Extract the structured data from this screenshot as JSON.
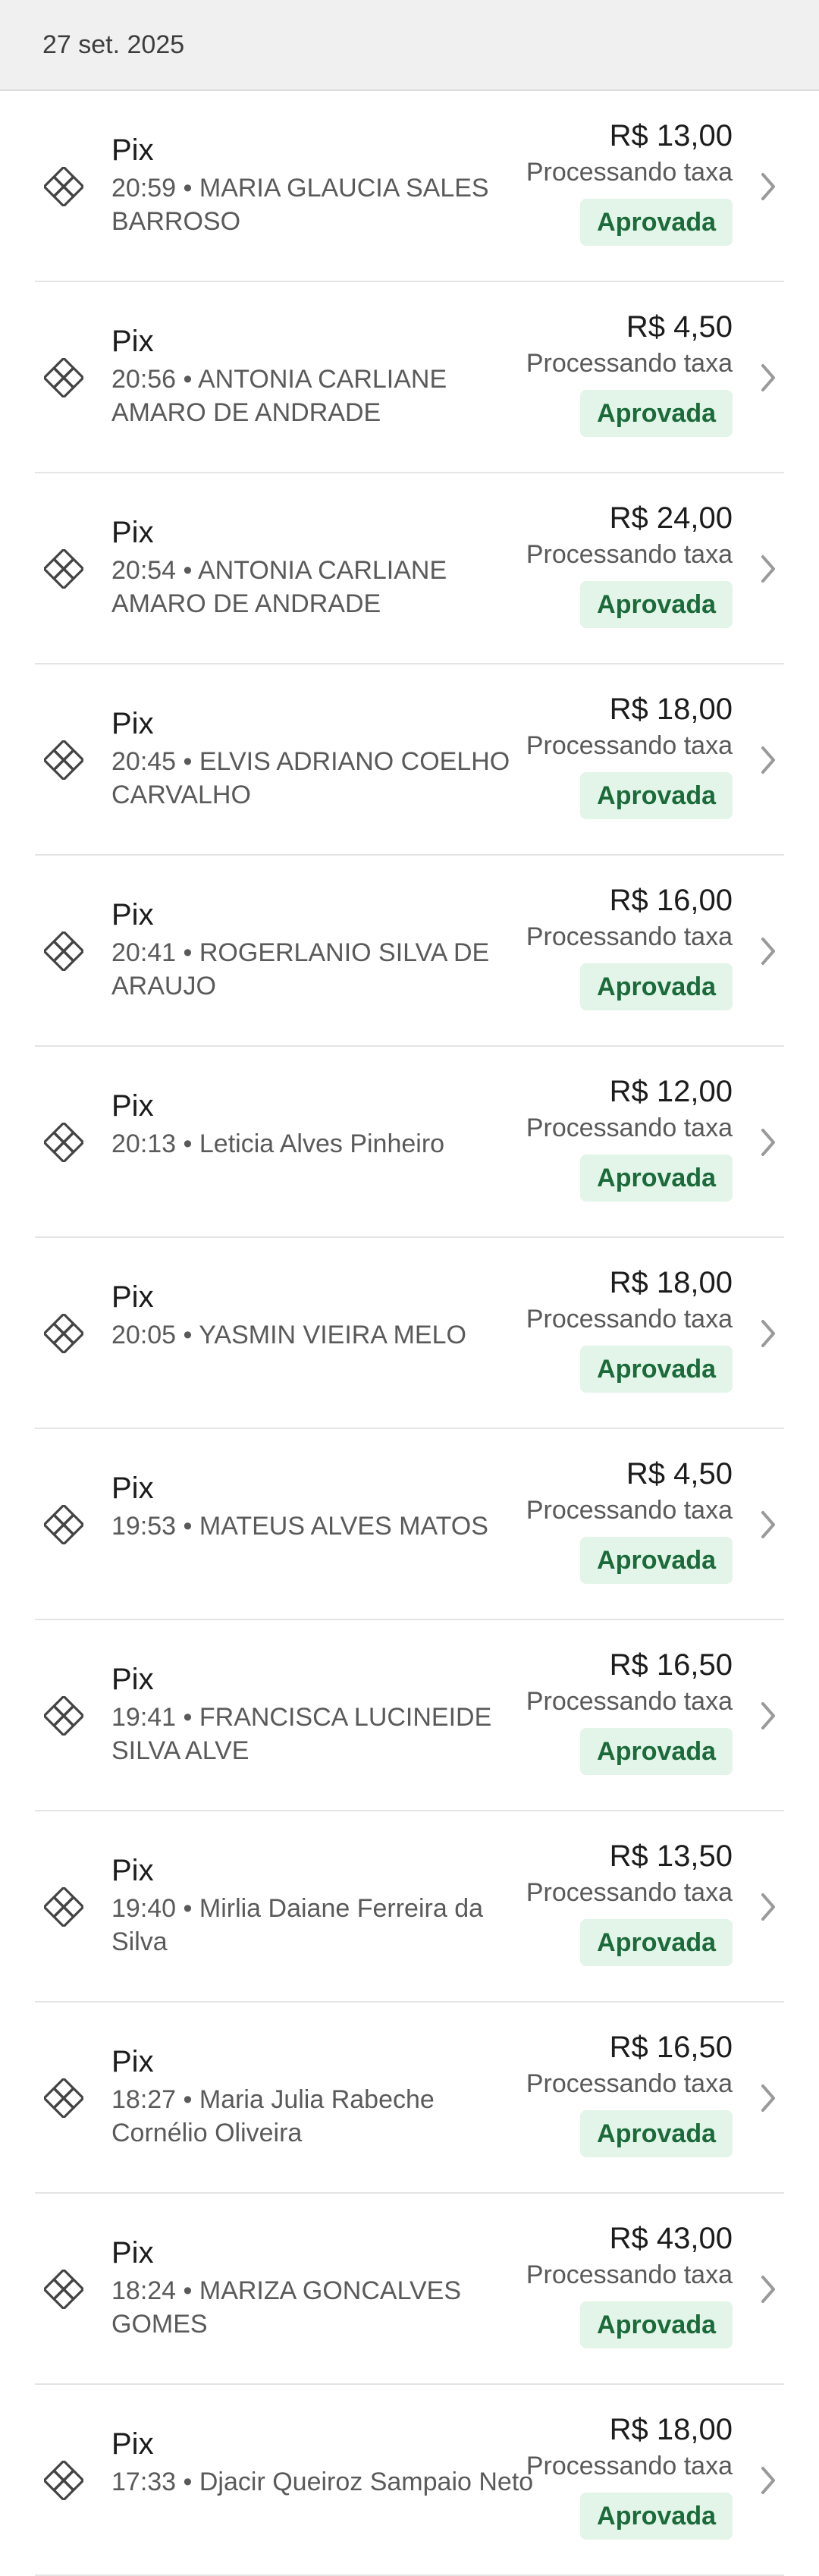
{
  "date_header": "27 set. 2025",
  "transactions": [
    {
      "method": "Pix",
      "detail": "20:59 • MARIA GLAUCIA SALES BARROSO",
      "amount": "R$ 13,00",
      "fee_status": "Processando taxa",
      "status": "Aprovada",
      "icon": "pix-icon"
    },
    {
      "method": "Pix",
      "detail": "20:56 • ANTONIA CARLIANE AMARO DE ANDRADE",
      "amount": "R$ 4,50",
      "fee_status": "Processando taxa",
      "status": "Aprovada",
      "icon": "pix-icon"
    },
    {
      "method": "Pix",
      "detail": "20:54 • ANTONIA CARLIANE AMARO DE ANDRADE",
      "amount": "R$ 24,00",
      "fee_status": "Processando taxa",
      "status": "Aprovada",
      "icon": "pix-icon"
    },
    {
      "method": "Pix",
      "detail": "20:45 • ELVIS ADRIANO COELHO CARVALHO",
      "amount": "R$ 18,00",
      "fee_status": "Processando taxa",
      "status": "Aprovada",
      "icon": "pix-icon"
    },
    {
      "method": "Pix",
      "detail": "20:41 • ROGERLANIO SILVA DE ARAUJO",
      "amount": "R$ 16,00",
      "fee_status": "Processando taxa",
      "status": "Aprovada",
      "icon": "pix-icon"
    },
    {
      "method": "Pix",
      "detail": "20:13 • Leticia Alves Pinheiro",
      "amount": "R$ 12,00",
      "fee_status": "Processando taxa",
      "status": "Aprovada",
      "icon": "pix-icon"
    },
    {
      "method": "Pix",
      "detail": "20:05 • YASMIN VIEIRA MELO",
      "amount": "R$ 18,00",
      "fee_status": "Processando taxa",
      "status": "Aprovada",
      "icon": "pix-icon"
    },
    {
      "method": "Pix",
      "detail": "19:53 • MATEUS ALVES MATOS",
      "amount": "R$ 4,50",
      "fee_status": "Processando taxa",
      "status": "Aprovada",
      "icon": "pix-icon"
    },
    {
      "method": "Pix",
      "detail": "19:41 • FRANCISCA LUCINEIDE SILVA ALVE",
      "amount": "R$ 16,50",
      "fee_status": "Processando taxa",
      "status": "Aprovada",
      "icon": "pix-icon"
    },
    {
      "method": "Pix",
      "detail": "19:40 • Mirlia Daiane Ferreira da Silva",
      "amount": "R$ 13,50",
      "fee_status": "Processando taxa",
      "status": "Aprovada",
      "icon": "pix-icon"
    },
    {
      "method": "Pix",
      "detail": "18:27 • Maria Julia Rabeche Cornélio Oliveira",
      "amount": "R$ 16,50",
      "fee_status": "Processando taxa",
      "status": "Aprovada",
      "icon": "pix-icon"
    },
    {
      "method": "Pix",
      "detail": "18:24 • MARIZA GONCALVES GOMES",
      "amount": "R$ 43,00",
      "fee_status": "Processando taxa",
      "status": "Aprovada",
      "icon": "pix-icon"
    },
    {
      "method": "Pix",
      "detail": "17:33 • Djacir Queiroz Sampaio Neto",
      "amount": "R$ 18,00",
      "fee_status": "Processando taxa",
      "status": "Aprovada",
      "icon": "pix-icon"
    }
  ],
  "colors": {
    "header_bg": "#f0f0f0",
    "badge_bg": "#e3f4e8",
    "badge_text": "#1b6b3a",
    "secondary_text": "#5a5a5a",
    "divider": "#e4e4e4"
  }
}
